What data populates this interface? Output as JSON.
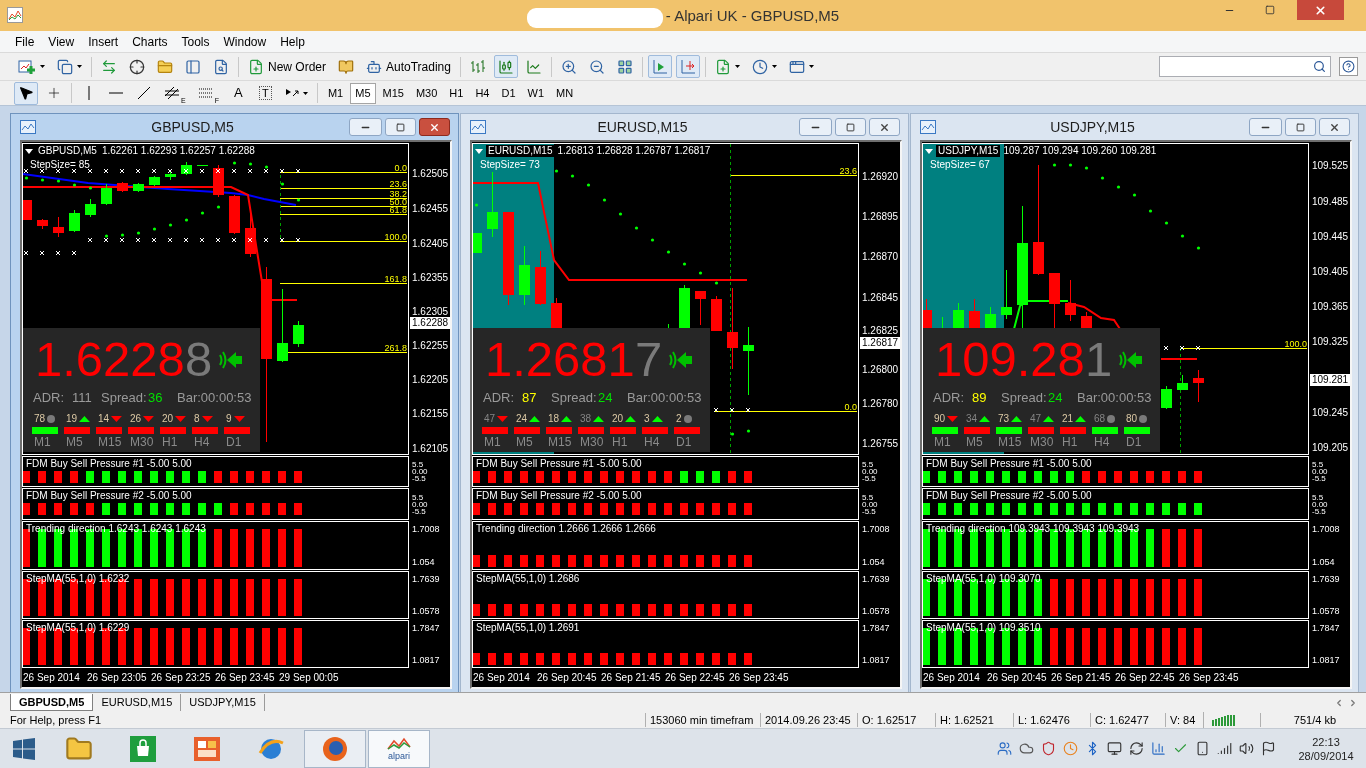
{
  "window": {
    "title": "- Alpari UK - GBPUSD,M5"
  },
  "menu": [
    "File",
    "View",
    "Insert",
    "Charts",
    "Tools",
    "Window",
    "Help"
  ],
  "toolbar": [
    [
      {
        "kind": "menu",
        "pressed": false
      },
      {
        "kind": "menu",
        "pressed": false
      }
    ],
    [
      {
        "kind": "button",
        "pressed": false
      },
      {
        "kind": "button",
        "pressed": false
      },
      {
        "kind": "button",
        "pressed": false
      },
      {
        "kind": "button",
        "pressed": false
      },
      {
        "kind": "button",
        "pressed": false
      }
    ],
    [
      {
        "kind": "button",
        "label": "New Order",
        "pressed": false
      },
      {
        "kind": "button",
        "pressed": false
      },
      {
        "kind": "button",
        "label": "AutoTrading",
        "pressed": false
      }
    ],
    [
      {
        "kind": "button",
        "pressed": false
      },
      {
        "kind": "button",
        "pressed": true
      },
      {
        "kind": "button",
        "pressed": false
      }
    ],
    [
      {
        "kind": "button",
        "pressed": false
      },
      {
        "kind": "button",
        "pressed": false
      },
      {
        "kind": "button",
        "pressed": false
      }
    ],
    [
      {
        "kind": "button",
        "pressed": true
      },
      {
        "kind": "button",
        "pressed": true
      }
    ],
    [
      {
        "kind": "menu",
        "pressed": false
      },
      {
        "kind": "menu",
        "pressed": false
      },
      {
        "kind": "menu",
        "pressed": false
      }
    ]
  ],
  "drawing_tools": [
    [
      {
        "kind": "button",
        "pressed": true
      },
      {
        "kind": "button",
        "pressed": false
      }
    ],
    [
      {
        "kind": "button",
        "pressed": false
      },
      {
        "kind": "button",
        "pressed": false
      },
      {
        "kind": "button",
        "pressed": false
      },
      {
        "kind": "button",
        "label": "E",
        "pressed": false
      },
      {
        "kind": "button",
        "label": "F",
        "pressed": false
      },
      {
        "kind": "button",
        "label": "A",
        "pressed": false
      },
      {
        "kind": "button",
        "label": "T",
        "pressed": false
      },
      {
        "kind": "menu",
        "pressed": false
      }
    ]
  ],
  "timeframes": [
    {
      "label": "M1",
      "selected": false
    },
    {
      "label": "M5",
      "selected": true
    },
    {
      "label": "M15",
      "selected": false
    },
    {
      "label": "M30",
      "selected": false
    },
    {
      "label": "H1",
      "selected": false
    },
    {
      "label": "H4",
      "selected": false
    },
    {
      "label": "D1",
      "selected": false
    },
    {
      "label": "W1",
      "selected": false
    },
    {
      "label": "MN",
      "selected": false
    }
  ],
  "charts": [
    {
      "title": "GBPUSD,M5",
      "active": true,
      "symbol": "GBPUSD,M5",
      "ohlc": "1.62261 1.62293 1.62257 1.62288",
      "step_size": "StepSize= 85",
      "fib_levels": [
        "0.0",
        "23.6",
        "38.2",
        "50.0",
        "61.8",
        "100.0",
        "161.8",
        "261.8"
      ],
      "price_axis": [
        "1.62505",
        "1.62455",
        "1.62405",
        "1.62355",
        "1.62305",
        "1.62255",
        "1.62205",
        "1.62155",
        "1.62105"
      ],
      "current_price": "1.62288",
      "panel": {
        "price": "1.6228",
        "last_digit": "8",
        "adr_label": "ADR:",
        "adr": {
          "value": "111",
          "color": "#9a9a9a"
        },
        "spread_label": "Spread:",
        "spread": "36",
        "bar_timer": "Bar:00:00:53",
        "timeframes": [
          {
            "count": "78",
            "kind": "flat",
            "color": "#00ff00",
            "label": "M1",
            "dim": false
          },
          {
            "count": "19",
            "kind": "up",
            "color": "#ff0000",
            "label": "M5",
            "dim": false
          },
          {
            "count": "14",
            "kind": "down",
            "color": "#ff0000",
            "label": "M15",
            "dim": false
          },
          {
            "count": "26",
            "kind": "down",
            "color": "#ff0000",
            "label": "M30",
            "dim": false
          },
          {
            "count": "20",
            "kind": "down",
            "color": "#ff0000",
            "label": "H1",
            "dim": false
          },
          {
            "count": "8",
            "kind": "down",
            "color": "#ff0000",
            "label": "H4",
            "dim": false
          },
          {
            "count": "9",
            "kind": "down",
            "color": "#ff0000",
            "label": "D1",
            "dim": false
          }
        ]
      },
      "indicators": [
        {
          "title": "FDM Buy Sell Pressure #1 -5.00 5.00",
          "kind": "pressure",
          "scale": [
            "5.5",
            "0.00",
            "-5.5"
          ],
          "bars": [
            {
              "color": "#ff0000"
            },
            {
              "color": "#ff0000"
            },
            {
              "color": "#ff0000"
            },
            {
              "color": "#ff0000"
            },
            {
              "color": "#00ff00"
            },
            {
              "color": "#00ff00"
            },
            {
              "color": "#00ff00"
            },
            {
              "color": "#00ff00"
            },
            {
              "color": "#00ff00"
            },
            {
              "color": "#00ff00"
            },
            {
              "color": "#00ff00"
            },
            {
              "color": "#00ff00"
            },
            {
              "color": "#ff0000"
            },
            {
              "color": "#ff0000"
            },
            {
              "color": "#ff0000"
            },
            {
              "color": "#ff0000"
            },
            {
              "color": "#ff0000"
            },
            {
              "color": "#ff0000"
            }
          ]
        },
        {
          "title": "FDM Buy Sell Pressure #2 -5.00 5.00",
          "kind": "pressure",
          "scale": [
            "5.5",
            "0.00",
            "-5.5"
          ],
          "bars": [
            {
              "color": "#ff0000"
            },
            {
              "color": "#ff0000"
            },
            {
              "color": "#ff0000"
            },
            {
              "color": "#ff0000"
            },
            {
              "color": "#ff0000"
            },
            {
              "color": "#00ff00"
            },
            {
              "color": "#00ff00"
            },
            {
              "color": "#00ff00"
            },
            {
              "color": "#00ff00"
            },
            {
              "color": "#00ff00"
            },
            {
              "color": "#00ff00"
            },
            {
              "color": "#00ff00"
            },
            {
              "color": "#00ff00"
            },
            {
              "color": "#ff0000"
            },
            {
              "color": "#ff0000"
            },
            {
              "color": "#ff0000"
            },
            {
              "color": "#ff0000"
            },
            {
              "color": "#ff0000"
            }
          ]
        },
        {
          "title": "Trending direction 1.6243 1.6243 1.6243",
          "kind": "full",
          "scale": [
            "1.7008",
            "1.054"
          ],
          "bars": [
            {
              "color": "#ff0000"
            },
            {
              "color": "#00ff00"
            },
            {
              "color": "#00ff00"
            },
            {
              "color": "#00ff00"
            },
            {
              "color": "#00ff00"
            },
            {
              "color": "#00ff00"
            },
            {
              "color": "#00ff00"
            },
            {
              "color": "#00ff00"
            },
            {
              "color": "#00ff00"
            },
            {
              "color": "#00ff00"
            },
            {
              "color": "#00ff00"
            },
            {
              "color": "#00ff00"
            },
            {
              "color": "#ff0000"
            },
            {
              "color": "#ff0000"
            },
            {
              "color": "#ff0000"
            },
            {
              "color": "#ff0000"
            },
            {
              "color": "#ff0000"
            },
            {
              "color": "#ff0000"
            }
          ]
        },
        {
          "title": "StepMA(55,1,0) 1.6232",
          "kind": "full",
          "scale": [
            "1.7639",
            "1.0578"
          ],
          "bars": [
            {
              "color": "#ff0000"
            },
            {
              "color": "#ff0000"
            },
            {
              "color": "#ff0000"
            },
            {
              "color": "#ff0000"
            },
            {
              "color": "#ff0000"
            },
            {
              "color": "#ff0000"
            },
            {
              "color": "#ff0000"
            },
            {
              "color": "#ff0000"
            },
            {
              "color": "#ff0000"
            },
            {
              "color": "#ff0000"
            },
            {
              "color": "#ff0000"
            },
            {
              "color": "#ff0000"
            },
            {
              "color": "#ff0000"
            },
            {
              "color": "#ff0000"
            },
            {
              "color": "#ff0000"
            },
            {
              "color": "#ff0000"
            },
            {
              "color": "#ff0000"
            },
            {
              "color": "#ff0000"
            }
          ]
        },
        {
          "title": "StepMA(55,1,0) 1.6229",
          "kind": "full",
          "scale": [
            "1.7847",
            "1.0817"
          ],
          "bars": [
            {
              "color": "#ff0000"
            },
            {
              "color": "#ff0000"
            },
            {
              "color": "#ff0000"
            },
            {
              "color": "#ff0000"
            },
            {
              "color": "#ff0000"
            },
            {
              "color": "#ff0000"
            },
            {
              "color": "#ff0000"
            },
            {
              "color": "#ff0000"
            },
            {
              "color": "#ff0000"
            },
            {
              "color": "#ff0000"
            },
            {
              "color": "#ff0000"
            },
            {
              "color": "#ff0000"
            },
            {
              "color": "#ff0000"
            },
            {
              "color": "#ff0000"
            },
            {
              "color": "#ff0000"
            },
            {
              "color": "#ff0000"
            },
            {
              "color": "#ff0000"
            },
            {
              "color": "#ff0000"
            }
          ]
        }
      ],
      "time_axis": [
        "26 Sep 2014",
        "26 Sep 23:05",
        "26 Sep 23:25",
        "26 Sep 23:45",
        "29 Sep 00:05"
      ]
    },
    {
      "title": "EURUSD,M15",
      "active": false,
      "symbol": "EURUSD,M15",
      "ohlc": "1.26813 1.26828 1.26787 1.26817",
      "step_size": "StepSize= 73",
      "fib_levels": [
        "23.6",
        "0.0"
      ],
      "price_axis": [
        "1.26920",
        "1.26895",
        "1.26870",
        "1.26845",
        "1.26825",
        "1.26800",
        "1.26780",
        "1.26755"
      ],
      "current_price": "1.26817",
      "panel": {
        "price": "1.2681",
        "last_digit": "7",
        "adr_label": "ADR:",
        "adr": {
          "value": "87",
          "color": "#ffff00"
        },
        "spread_label": "Spread:",
        "spread": "24",
        "bar_timer": "Bar:00:00:53",
        "timeframes": [
          {
            "count": "47",
            "kind": "down",
            "color": "#ff0000",
            "label": "M1",
            "dim": true
          },
          {
            "count": "24",
            "kind": "up",
            "color": "#ff0000",
            "label": "M5",
            "dim": false
          },
          {
            "count": "18",
            "kind": "up",
            "color": "#ff0000",
            "label": "M15",
            "dim": false
          },
          {
            "count": "38",
            "kind": "up",
            "color": "#ff0000",
            "label": "M30",
            "dim": true
          },
          {
            "count": "20",
            "kind": "up",
            "color": "#ff0000",
            "label": "H1",
            "dim": false
          },
          {
            "count": "3",
            "kind": "up",
            "color": "#ff0000",
            "label": "H4",
            "dim": false
          },
          {
            "count": "2",
            "kind": "flat",
            "color": "#ff0000",
            "label": "D1",
            "dim": false
          }
        ]
      },
      "indicators": [
        {
          "title": "FDM Buy Sell Pressure #1 -5.00 5.00",
          "kind": "pressure",
          "scale": [
            "5.5",
            "0.00",
            "-5.5"
          ],
          "bars": [
            {
              "color": "#ff0000"
            },
            {
              "color": "#ff0000"
            },
            {
              "color": "#ff0000"
            },
            {
              "color": "#ff0000"
            },
            {
              "color": "#ff0000"
            },
            {
              "color": "#ff0000"
            },
            {
              "color": "#ff0000"
            },
            {
              "color": "#ff0000"
            },
            {
              "color": "#ff0000"
            },
            {
              "color": "#ff0000"
            },
            {
              "color": "#ff0000"
            },
            {
              "color": "#ff0000"
            },
            {
              "color": "#ff0000"
            },
            {
              "color": "#00ff00"
            },
            {
              "color": "#00ff00"
            },
            {
              "color": "#00ff00"
            },
            {
              "color": "#ff0000"
            },
            {
              "color": "#ff0000"
            }
          ]
        },
        {
          "title": "FDM Buy Sell Pressure #2 -5.00 5.00",
          "kind": "pressure",
          "scale": [
            "5.5",
            "0.00",
            "-5.5"
          ],
          "bars": [
            {
              "color": "#ff0000"
            },
            {
              "color": "#ff0000"
            },
            {
              "color": "#ff0000"
            },
            {
              "color": "#ff0000"
            },
            {
              "color": "#ff0000"
            },
            {
              "color": "#ff0000"
            },
            {
              "color": "#ff0000"
            },
            {
              "color": "#ff0000"
            },
            {
              "color": "#ff0000"
            },
            {
              "color": "#ff0000"
            },
            {
              "color": "#ff0000"
            },
            {
              "color": "#ff0000"
            },
            {
              "color": "#ff0000"
            },
            {
              "color": "#ff0000"
            },
            {
              "color": "#ff0000"
            },
            {
              "color": "#ff0000"
            },
            {
              "color": "#ff0000"
            },
            {
              "color": "#ff0000"
            }
          ]
        },
        {
          "title": "Trending direction 1.2666 1.2666 1.2666",
          "kind": "low",
          "scale": [
            "1.7008",
            "1.054"
          ],
          "bars": [
            {
              "color": "#ff0000"
            },
            {
              "color": "#ff0000"
            },
            {
              "color": "#ff0000"
            },
            {
              "color": "#ff0000"
            },
            {
              "color": "#ff0000"
            },
            {
              "color": "#ff0000"
            },
            {
              "color": "#ff0000"
            },
            {
              "color": "#ff0000"
            },
            {
              "color": "#ff0000"
            },
            {
              "color": "#ff0000"
            },
            {
              "color": "#ff0000"
            },
            {
              "color": "#ff0000"
            },
            {
              "color": "#ff0000"
            },
            {
              "color": "#ff0000"
            },
            {
              "color": "#ff0000"
            },
            {
              "color": "#ff0000"
            },
            {
              "color": "#ff0000"
            },
            {
              "color": "#ff0000"
            }
          ]
        },
        {
          "title": "StepMA(55,1,0) 1.2686",
          "kind": "low",
          "scale": [
            "1.7639",
            "1.0578"
          ],
          "bars": [
            {
              "color": "#ff0000"
            },
            {
              "color": "#ff0000"
            },
            {
              "color": "#ff0000"
            },
            {
              "color": "#ff0000"
            },
            {
              "color": "#ff0000"
            },
            {
              "color": "#ff0000"
            },
            {
              "color": "#ff0000"
            },
            {
              "color": "#ff0000"
            },
            {
              "color": "#ff0000"
            },
            {
              "color": "#ff0000"
            },
            {
              "color": "#ff0000"
            },
            {
              "color": "#ff0000"
            },
            {
              "color": "#ff0000"
            },
            {
              "color": "#ff0000"
            },
            {
              "color": "#ff0000"
            },
            {
              "color": "#ff0000"
            },
            {
              "color": "#ff0000"
            },
            {
              "color": "#ff0000"
            }
          ]
        },
        {
          "title": "StepMA(55,1,0) 1.2691",
          "kind": "low",
          "scale": [
            "1.7847",
            "1.0817"
          ],
          "bars": [
            {
              "color": "#ff0000"
            },
            {
              "color": "#ff0000"
            },
            {
              "color": "#ff0000"
            },
            {
              "color": "#ff0000"
            },
            {
              "color": "#ff0000"
            },
            {
              "color": "#ff0000"
            },
            {
              "color": "#ff0000"
            },
            {
              "color": "#ff0000"
            },
            {
              "color": "#ff0000"
            },
            {
              "color": "#ff0000"
            },
            {
              "color": "#ff0000"
            },
            {
              "color": "#ff0000"
            },
            {
              "color": "#ff0000"
            },
            {
              "color": "#ff0000"
            },
            {
              "color": "#ff0000"
            },
            {
              "color": "#ff0000"
            },
            {
              "color": "#ff0000"
            },
            {
              "color": "#ff0000"
            }
          ]
        }
      ],
      "time_axis": [
        "26 Sep 2014",
        "26 Sep 20:45",
        "26 Sep 21:45",
        "26 Sep 22:45",
        "26 Sep 23:45"
      ]
    },
    {
      "title": "USDJPY,M15",
      "active": false,
      "symbol": "USDJPY,M15",
      "ohlc": "109.287 109.294 109.260 109.281",
      "step_size": "StepSize= 67",
      "fib_levels": [
        "100.0"
      ],
      "price_axis": [
        "109.525",
        "109.485",
        "109.445",
        "109.405",
        "109.365",
        "109.325",
        "109.245",
        "109.205"
      ],
      "current_price": "109.281",
      "panel": {
        "price": "109.28",
        "last_digit": "1",
        "adr_label": "ADR:",
        "adr": {
          "value": "89",
          "color": "#ffff00"
        },
        "spread_label": "Spread:",
        "spread": "24",
        "bar_timer": "Bar:00:00:53",
        "timeframes": [
          {
            "count": "90",
            "kind": "down",
            "color": "#00ff00",
            "label": "M1",
            "dim": false
          },
          {
            "count": "34",
            "kind": "up",
            "color": "#ff0000",
            "label": "M5",
            "dim": true
          },
          {
            "count": "73",
            "kind": "up",
            "color": "#00ff00",
            "label": "M15",
            "dim": false
          },
          {
            "count": "47",
            "kind": "up",
            "color": "#ff0000",
            "label": "M30",
            "dim": true
          },
          {
            "count": "21",
            "kind": "up",
            "color": "#ff0000",
            "label": "H1",
            "dim": false
          },
          {
            "count": "68",
            "kind": "flat",
            "color": "#00ff00",
            "label": "H4",
            "dim": true
          },
          {
            "count": "80",
            "kind": "flat",
            "color": "#00ff00",
            "label": "D1",
            "dim": false
          }
        ]
      },
      "indicators": [
        {
          "title": "FDM Buy Sell Pressure #1 -5.00 5.00",
          "kind": "pressure",
          "scale": [
            "5.5",
            "0.00",
            "-5.5"
          ],
          "bars": [
            {
              "color": "#00ff00"
            },
            {
              "color": "#00ff00"
            },
            {
              "color": "#00ff00"
            },
            {
              "color": "#00ff00"
            },
            {
              "color": "#00ff00"
            },
            {
              "color": "#00ff00"
            },
            {
              "color": "#00ff00"
            },
            {
              "color": "#00ff00"
            },
            {
              "color": "#00ff00"
            },
            {
              "color": "#00ff00"
            },
            {
              "color": "#ff0000"
            },
            {
              "color": "#ff0000"
            },
            {
              "color": "#ff0000"
            },
            {
              "color": "#ff0000"
            },
            {
              "color": "#ff0000"
            },
            {
              "color": "#ff0000"
            },
            {
              "color": "#ff0000"
            },
            {
              "color": "#ff0000"
            }
          ]
        },
        {
          "title": "FDM Buy Sell Pressure #2 -5.00 5.00",
          "kind": "pressure",
          "scale": [
            "5.5",
            "0.00",
            "-5.5"
          ],
          "bars": [
            {
              "color": "#00ff00"
            },
            {
              "color": "#00ff00"
            },
            {
              "color": "#00ff00"
            },
            {
              "color": "#00ff00"
            },
            {
              "color": "#00ff00"
            },
            {
              "color": "#00ff00"
            },
            {
              "color": "#00ff00"
            },
            {
              "color": "#00ff00"
            },
            {
              "color": "#00ff00"
            },
            {
              "color": "#00ff00"
            },
            {
              "color": "#00ff00"
            },
            {
              "color": "#00ff00"
            },
            {
              "color": "#00ff00"
            },
            {
              "color": "#00ff00"
            },
            {
              "color": "#00ff00"
            },
            {
              "color": "#00ff00"
            },
            {
              "color": "#00ff00"
            },
            {
              "color": "#00ff00"
            }
          ]
        },
        {
          "title": "Trending direction 109.3943 109.3943 109.3943",
          "kind": "full",
          "scale": [
            "1.7008",
            "1.054"
          ],
          "bars": [
            {
              "color": "#00ff00"
            },
            {
              "color": "#00ff00"
            },
            {
              "color": "#00ff00"
            },
            {
              "color": "#00ff00"
            },
            {
              "color": "#00ff00"
            },
            {
              "color": "#00ff00"
            },
            {
              "color": "#00ff00"
            },
            {
              "color": "#00ff00"
            },
            {
              "color": "#00ff00"
            },
            {
              "color": "#00ff00"
            },
            {
              "color": "#00ff00"
            },
            {
              "color": "#00ff00"
            },
            {
              "color": "#00ff00"
            },
            {
              "color": "#00ff00"
            },
            {
              "color": "#00ff00"
            },
            {
              "color": "#ff0000"
            },
            {
              "color": "#ff0000"
            },
            {
              "color": "#ff0000"
            }
          ]
        },
        {
          "title": "StepMA(55,1,0) 109.3070",
          "kind": "full",
          "scale": [
            "1.7639",
            "1.0578"
          ],
          "bars": [
            {
              "color": "#00ff00"
            },
            {
              "color": "#00ff00"
            },
            {
              "color": "#00ff00"
            },
            {
              "color": "#00ff00"
            },
            {
              "color": "#00ff00"
            },
            {
              "color": "#00ff00"
            },
            {
              "color": "#00ff00"
            },
            {
              "color": "#00ff00"
            },
            {
              "color": "#ff0000"
            },
            {
              "color": "#ff0000"
            },
            {
              "color": "#ff0000"
            },
            {
              "color": "#ff0000"
            },
            {
              "color": "#ff0000"
            },
            {
              "color": "#ff0000"
            },
            {
              "color": "#ff0000"
            },
            {
              "color": "#ff0000"
            },
            {
              "color": "#ff0000"
            },
            {
              "color": "#ff0000"
            }
          ]
        },
        {
          "title": "StepMA(55,1,0) 109.3510",
          "kind": "full",
          "scale": [
            "1.7847",
            "1.0817"
          ],
          "bars": [
            {
              "color": "#00ff00"
            },
            {
              "color": "#00ff00"
            },
            {
              "color": "#00ff00"
            },
            {
              "color": "#00ff00"
            },
            {
              "color": "#00ff00"
            },
            {
              "color": "#00ff00"
            },
            {
              "color": "#00ff00"
            },
            {
              "color": "#00ff00"
            },
            {
              "color": "#ff0000"
            },
            {
              "color": "#ff0000"
            },
            {
              "color": "#ff0000"
            },
            {
              "color": "#ff0000"
            },
            {
              "color": "#ff0000"
            },
            {
              "color": "#ff0000"
            },
            {
              "color": "#ff0000"
            },
            {
              "color": "#ff0000"
            },
            {
              "color": "#ff0000"
            },
            {
              "color": "#ff0000"
            }
          ]
        }
      ],
      "time_axis": [
        "26 Sep 2014",
        "26 Sep 20:45",
        "26 Sep 21:45",
        "26 Sep 22:45",
        "26 Sep 23:45"
      ]
    }
  ],
  "chart_tabs": [
    {
      "label": "GBPUSD,M5",
      "selected": true
    },
    {
      "label": "EURUSD,M15",
      "selected": false
    },
    {
      "label": "USDJPY,M15",
      "selected": false
    }
  ],
  "status_bar": {
    "help": "For Help, press F1",
    "fields": [
      "153060 min timefram",
      "2014.09.26 23:45",
      "O: 1.62517",
      "H: 1.62521",
      "L: 1.62476",
      "C: 1.62477",
      "V: 84"
    ],
    "traffic": "751/4 kb"
  },
  "taskbar": {
    "apps": [
      {
        "running": false,
        "active": false
      },
      {
        "running": false,
        "active": false
      },
      {
        "running": false,
        "active": false
      },
      {
        "running": false,
        "active": false
      },
      {
        "running": true,
        "active": false
      },
      {
        "label": "alpari",
        "running": true,
        "active": true
      }
    ],
    "time": "22:13",
    "date": "28/09/2014"
  }
}
